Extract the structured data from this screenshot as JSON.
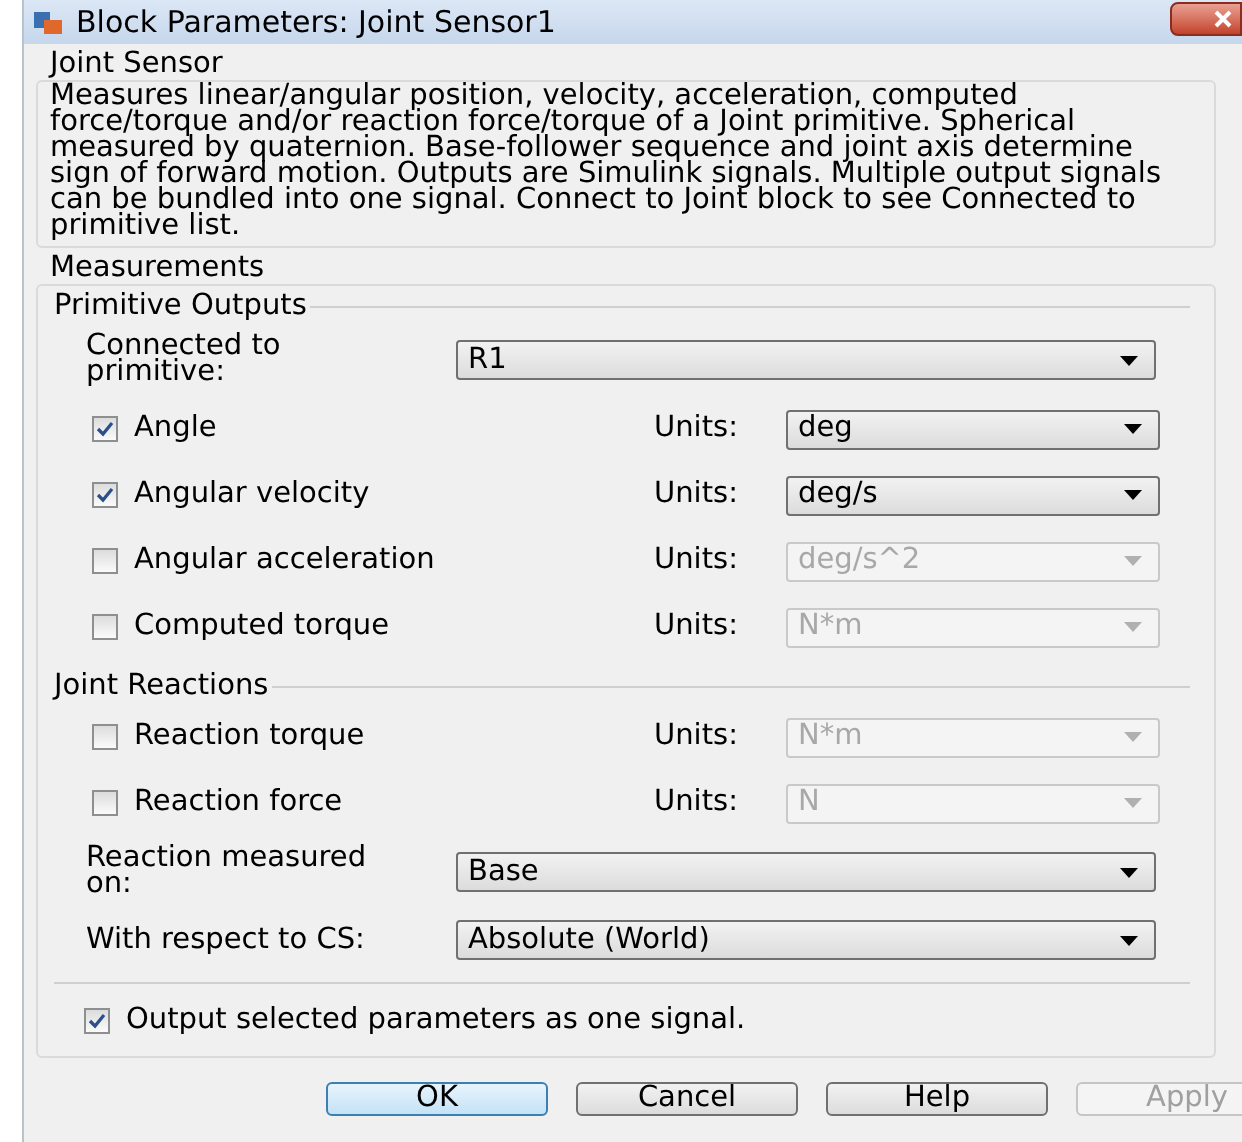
{
  "window": {
    "title": "Block Parameters: Joint Sensor1"
  },
  "description": {
    "title": "Joint Sensor",
    "text": "Measures linear/angular position, velocity, acceleration, computed force/torque and/or reaction force/torque of a Joint primitive. Spherical measured by quaternion. Base-follower sequence and joint axis determine sign of forward motion. Outputs are Simulink signals. Multiple output signals can be bundled into one signal. Connect to Joint block to see Connected to primitive list."
  },
  "measurements": {
    "title": "Measurements",
    "groups": [
      {
        "title": "Primitive Outputs",
        "rows": [
          {
            "kind": "select",
            "label": "Connected to primitive:",
            "value": "R1",
            "disabled": false
          },
          {
            "kind": "check",
            "label": "Angle",
            "checked": true,
            "units_label": "Units:",
            "value": "deg",
            "disabled": false
          },
          {
            "kind": "check",
            "label": "Angular velocity",
            "checked": true,
            "units_label": "Units:",
            "value": "deg/s",
            "disabled": false
          },
          {
            "kind": "check",
            "label": "Angular acceleration",
            "checked": false,
            "units_label": "Units:",
            "value": "deg/s^2",
            "disabled": true
          },
          {
            "kind": "check",
            "label": "Computed torque",
            "checked": false,
            "units_label": "Units:",
            "value": "N*m",
            "disabled": true
          }
        ]
      },
      {
        "title": "Joint Reactions",
        "rows": [
          {
            "kind": "check",
            "label": "Reaction torque",
            "checked": false,
            "units_label": "Units:",
            "value": "N*m",
            "disabled": true
          },
          {
            "kind": "check",
            "label": "Reaction force",
            "checked": false,
            "units_label": "Units:",
            "value": "N",
            "disabled": true
          },
          {
            "kind": "select",
            "label": "Reaction measured on:",
            "value": "Base",
            "disabled": false
          },
          {
            "kind": "select",
            "label": "With respect to CS:",
            "value": "Absolute (World)",
            "disabled": false
          }
        ]
      }
    ],
    "output_option": {
      "label": "Output selected parameters as one signal.",
      "checked": true
    }
  },
  "buttons": [
    {
      "label": "OK",
      "selected": true,
      "disabled": false
    },
    {
      "label": "Cancel",
      "selected": false,
      "disabled": false
    },
    {
      "label": "Help",
      "selected": false,
      "disabled": false
    },
    {
      "label": "Apply",
      "selected": false,
      "disabled": true
    }
  ]
}
